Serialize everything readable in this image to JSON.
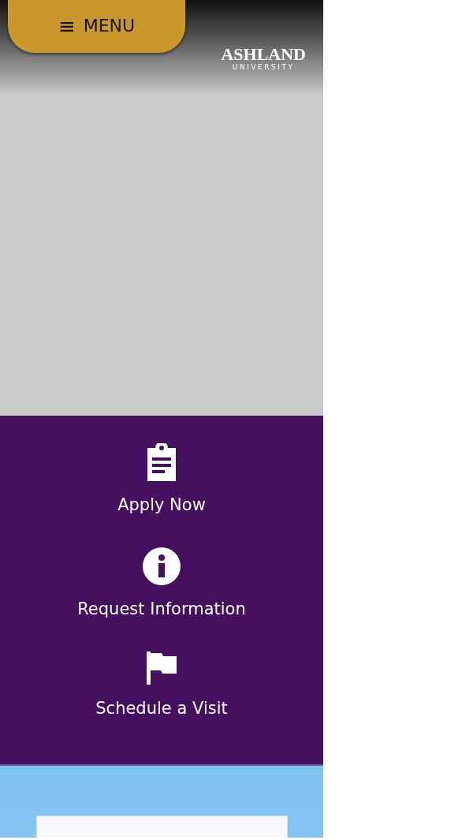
{
  "header": {
    "menu_button": {
      "icon": "≡",
      "label": "MENU"
    },
    "logo": {
      "name": "ASHLAND",
      "subtitle": "UNIVERSITY"
    }
  },
  "actions": [
    {
      "kind": "clipboard",
      "label": "Apply Now"
    },
    {
      "kind": "info",
      "label": "Request Information"
    },
    {
      "kind": "flag",
      "label": "Schedule a Visit"
    }
  ]
}
